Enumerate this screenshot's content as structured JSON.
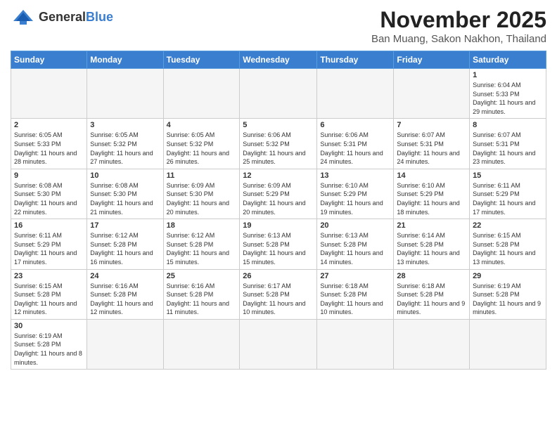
{
  "header": {
    "logo_general": "General",
    "logo_blue": "Blue",
    "month_title": "November 2025",
    "location": "Ban Muang, Sakon Nakhon, Thailand"
  },
  "weekdays": [
    "Sunday",
    "Monday",
    "Tuesday",
    "Wednesday",
    "Thursday",
    "Friday",
    "Saturday"
  ],
  "weeks": [
    [
      {
        "day": "",
        "empty": true
      },
      {
        "day": "",
        "empty": true
      },
      {
        "day": "",
        "empty": true
      },
      {
        "day": "",
        "empty": true
      },
      {
        "day": "",
        "empty": true
      },
      {
        "day": "",
        "empty": true
      },
      {
        "day": "1",
        "sunrise": "6:04 AM",
        "sunset": "5:33 PM",
        "daylight": "11 hours and 29 minutes."
      }
    ],
    [
      {
        "day": "2",
        "sunrise": "6:05 AM",
        "sunset": "5:33 PM",
        "daylight": "11 hours and 28 minutes."
      },
      {
        "day": "3",
        "sunrise": "6:05 AM",
        "sunset": "5:32 PM",
        "daylight": "11 hours and 27 minutes."
      },
      {
        "day": "4",
        "sunrise": "6:05 AM",
        "sunset": "5:32 PM",
        "daylight": "11 hours and 26 minutes."
      },
      {
        "day": "5",
        "sunrise": "6:06 AM",
        "sunset": "5:32 PM",
        "daylight": "11 hours and 25 minutes."
      },
      {
        "day": "6",
        "sunrise": "6:06 AM",
        "sunset": "5:31 PM",
        "daylight": "11 hours and 24 minutes."
      },
      {
        "day": "7",
        "sunrise": "6:07 AM",
        "sunset": "5:31 PM",
        "daylight": "11 hours and 24 minutes."
      },
      {
        "day": "8",
        "sunrise": "6:07 AM",
        "sunset": "5:31 PM",
        "daylight": "11 hours and 23 minutes."
      }
    ],
    [
      {
        "day": "9",
        "sunrise": "6:08 AM",
        "sunset": "5:30 PM",
        "daylight": "11 hours and 22 minutes."
      },
      {
        "day": "10",
        "sunrise": "6:08 AM",
        "sunset": "5:30 PM",
        "daylight": "11 hours and 21 minutes."
      },
      {
        "day": "11",
        "sunrise": "6:09 AM",
        "sunset": "5:30 PM",
        "daylight": "11 hours and 20 minutes."
      },
      {
        "day": "12",
        "sunrise": "6:09 AM",
        "sunset": "5:29 PM",
        "daylight": "11 hours and 20 minutes."
      },
      {
        "day": "13",
        "sunrise": "6:10 AM",
        "sunset": "5:29 PM",
        "daylight": "11 hours and 19 minutes."
      },
      {
        "day": "14",
        "sunrise": "6:10 AM",
        "sunset": "5:29 PM",
        "daylight": "11 hours and 18 minutes."
      },
      {
        "day": "15",
        "sunrise": "6:11 AM",
        "sunset": "5:29 PM",
        "daylight": "11 hours and 17 minutes."
      }
    ],
    [
      {
        "day": "16",
        "sunrise": "6:11 AM",
        "sunset": "5:29 PM",
        "daylight": "11 hours and 17 minutes."
      },
      {
        "day": "17",
        "sunrise": "6:12 AM",
        "sunset": "5:28 PM",
        "daylight": "11 hours and 16 minutes."
      },
      {
        "day": "18",
        "sunrise": "6:12 AM",
        "sunset": "5:28 PM",
        "daylight": "11 hours and 15 minutes."
      },
      {
        "day": "19",
        "sunrise": "6:13 AM",
        "sunset": "5:28 PM",
        "daylight": "11 hours and 15 minutes."
      },
      {
        "day": "20",
        "sunrise": "6:13 AM",
        "sunset": "5:28 PM",
        "daylight": "11 hours and 14 minutes."
      },
      {
        "day": "21",
        "sunrise": "6:14 AM",
        "sunset": "5:28 PM",
        "daylight": "11 hours and 13 minutes."
      },
      {
        "day": "22",
        "sunrise": "6:15 AM",
        "sunset": "5:28 PM",
        "daylight": "11 hours and 13 minutes."
      }
    ],
    [
      {
        "day": "23",
        "sunrise": "6:15 AM",
        "sunset": "5:28 PM",
        "daylight": "11 hours and 12 minutes."
      },
      {
        "day": "24",
        "sunrise": "6:16 AM",
        "sunset": "5:28 PM",
        "daylight": "11 hours and 12 minutes."
      },
      {
        "day": "25",
        "sunrise": "6:16 AM",
        "sunset": "5:28 PM",
        "daylight": "11 hours and 11 minutes."
      },
      {
        "day": "26",
        "sunrise": "6:17 AM",
        "sunset": "5:28 PM",
        "daylight": "11 hours and 10 minutes."
      },
      {
        "day": "27",
        "sunrise": "6:18 AM",
        "sunset": "5:28 PM",
        "daylight": "11 hours and 10 minutes."
      },
      {
        "day": "28",
        "sunrise": "6:18 AM",
        "sunset": "5:28 PM",
        "daylight": "11 hours and 9 minutes."
      },
      {
        "day": "29",
        "sunrise": "6:19 AM",
        "sunset": "5:28 PM",
        "daylight": "11 hours and 9 minutes."
      }
    ],
    [
      {
        "day": "30",
        "sunrise": "6:19 AM",
        "sunset": "5:28 PM",
        "daylight": "11 hours and 8 minutes."
      },
      {
        "day": "",
        "empty": true
      },
      {
        "day": "",
        "empty": true
      },
      {
        "day": "",
        "empty": true
      },
      {
        "day": "",
        "empty": true
      },
      {
        "day": "",
        "empty": true
      },
      {
        "day": "",
        "empty": true
      }
    ]
  ],
  "labels": {
    "sunrise": "Sunrise:",
    "sunset": "Sunset:",
    "daylight": "Daylight:"
  }
}
